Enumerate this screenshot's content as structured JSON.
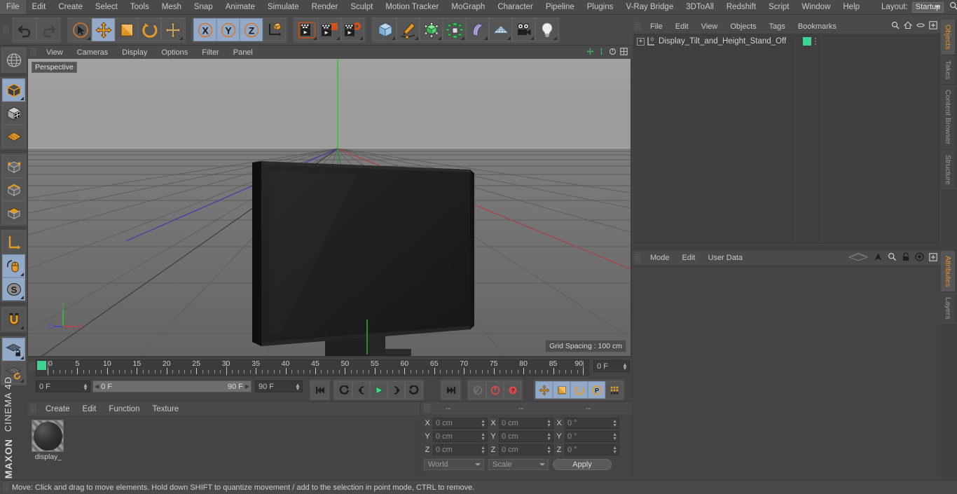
{
  "app": {
    "name": "CINEMA 4D",
    "brand_top": "MAXON",
    "brand_bottom": "CINEMA 4D"
  },
  "menubar": {
    "items": [
      "File",
      "Edit",
      "Create",
      "Select",
      "Tools",
      "Mesh",
      "Snap",
      "Animate",
      "Simulate",
      "Render",
      "Sculpt",
      "Motion Tracker",
      "MoGraph",
      "Character",
      "Pipeline",
      "Plugins",
      "V-Ray Bridge",
      "3DToAll",
      "Redshift",
      "Script",
      "Window",
      "Help"
    ],
    "layout_label": "Layout:",
    "layout_value": "Startup",
    "search_icon": "search-icon"
  },
  "main_toolbar": {
    "groups": [
      {
        "name": "undo-redo",
        "buttons": [
          {
            "icon": "undo-icon",
            "label": "Undo",
            "active": false
          },
          {
            "icon": "redo-icon",
            "label": "Redo",
            "active": false,
            "disabled": true
          }
        ]
      },
      {
        "name": "transform-tools",
        "buttons": [
          {
            "icon": "select-cursor-icon",
            "label": "Live Selection",
            "active": false
          },
          {
            "icon": "move-icon",
            "label": "Move",
            "active": true
          },
          {
            "icon": "scale-icon",
            "label": "Scale",
            "active": false
          },
          {
            "icon": "rotate-icon",
            "label": "Rotate",
            "active": false
          },
          {
            "icon": "move-alt-icon",
            "label": "Move Tool Variant",
            "active": false
          }
        ]
      },
      {
        "name": "axis-locks",
        "buttons": [
          {
            "icon": "x-axis-icon",
            "label": "X Axis",
            "active": true
          },
          {
            "icon": "y-axis-icon",
            "label": "Y Axis",
            "active": true
          },
          {
            "icon": "z-axis-icon",
            "label": "Z Axis",
            "active": true
          },
          {
            "icon": "world-coordinates-icon",
            "label": "World/Object Coordinates",
            "active": false
          }
        ]
      },
      {
        "name": "render-tools",
        "buttons": [
          {
            "icon": "render-view-icon",
            "label": "Render View",
            "active": false
          },
          {
            "icon": "render-region-icon",
            "label": "Render to Picture Viewer",
            "active": false
          },
          {
            "icon": "render-settings-icon",
            "label": "Edit Render Settings",
            "active": false
          }
        ]
      },
      {
        "name": "create-objects",
        "buttons": [
          {
            "icon": "cube-primitive-icon",
            "label": "Add Cube Object",
            "active": false
          },
          {
            "icon": "spline-pen-icon",
            "label": "Add Spline",
            "active": false
          },
          {
            "icon": "nurbs-icon",
            "label": "Add Generator Object",
            "active": false
          },
          {
            "icon": "array-icon",
            "label": "Add Array Object",
            "active": false
          },
          {
            "icon": "bend-deformer-icon",
            "label": "Add Bend Object",
            "active": false
          },
          {
            "icon": "floor-environment-icon",
            "label": "Add Floor/Environment",
            "active": false
          },
          {
            "icon": "camera-icon",
            "label": "Add Camera",
            "active": false
          },
          {
            "icon": "light-bulb-icon",
            "label": "Add Light",
            "active": false
          }
        ]
      }
    ]
  },
  "left_toolbar": {
    "buttons": [
      {
        "icon": "globe-deformed-icon",
        "label": "Make Editable",
        "active": false
      },
      {
        "icon": "model-mode-icon",
        "label": "Model Mode",
        "active": true
      },
      {
        "icon": "texture-mode-icon",
        "label": "Texture Mode",
        "active": false
      },
      {
        "icon": "workplane-icon",
        "label": "Workplane",
        "active": false
      },
      {
        "icon": "point-mode-icon",
        "label": "Points Mode",
        "active": false
      },
      {
        "icon": "edge-mode-icon",
        "label": "Edges Mode",
        "active": false
      },
      {
        "icon": "polygon-mode-icon",
        "label": "Polygons Mode",
        "active": false
      },
      {
        "icon": "axis-mode-icon",
        "label": "Enable Axis Modification",
        "active": false
      },
      {
        "icon": "viewport-solo-icon",
        "label": "Viewport Solo",
        "active": true
      },
      {
        "icon": "snap-enable-icon",
        "label": "Enable Snapping",
        "active": true
      },
      {
        "icon": "magnet-icon",
        "label": "Magnet Tool",
        "active": false
      },
      {
        "icon": "workplane-lock-icon",
        "label": "Lock Workplane",
        "active": true
      },
      {
        "icon": "workplane-rotate-icon",
        "label": "Planar Workplane Mode",
        "active": false
      }
    ]
  },
  "viewport": {
    "menu": [
      "View",
      "Cameras",
      "Display",
      "Options",
      "Filter",
      "Panel"
    ],
    "label": "Perspective",
    "grid_spacing": "Grid Spacing : 100 cm",
    "axis_labels": {
      "x": "X",
      "y": "Y",
      "z": "Z"
    },
    "axis_colors": {
      "x": "#d04040",
      "y": "#3ac03a",
      "z": "#4040d0"
    },
    "scene_object": "monitor display on stand"
  },
  "timeline": {
    "ruler": {
      "ticks": [
        0,
        5,
        10,
        15,
        20,
        25,
        30,
        35,
        40,
        45,
        50,
        55,
        60,
        65,
        70,
        75,
        80,
        85,
        90
      ],
      "start": 0,
      "end": 90,
      "current_frame_marker": 0
    },
    "current_frame_field": "0 F",
    "start_field": "0 F",
    "range_start": "0 F",
    "range_end": "90 F",
    "end_field": "90 F",
    "transport_buttons": [
      {
        "icon": "go-to-start-icon",
        "label": "Go to Start",
        "active": false
      },
      {
        "icon": "previous-key-icon",
        "label": "Go to Previous Key",
        "active": false
      },
      {
        "icon": "step-back-icon",
        "label": "Go to Previous Frame",
        "active": false
      },
      {
        "icon": "play-icon",
        "label": "Play Forwards",
        "active": false
      },
      {
        "icon": "step-forward-icon",
        "label": "Go to Next Frame",
        "active": false
      },
      {
        "icon": "next-key-icon",
        "label": "Go to Next Key",
        "active": false
      },
      {
        "icon": "go-to-end-icon",
        "label": "Go to End",
        "active": false
      }
    ],
    "record_buttons": [
      {
        "icon": "autokey-wrench-icon",
        "label": "Record Active Objects",
        "active": false
      },
      {
        "icon": "autokeying-icon",
        "label": "Autokeying",
        "active": false
      },
      {
        "icon": "keyframe-selection-icon",
        "label": "Keyframe Selection",
        "active": false
      }
    ],
    "key_toggles": [
      {
        "icon": "position-key-icon",
        "label": "Position",
        "active": true
      },
      {
        "icon": "scale-key-icon",
        "label": "Scale",
        "active": true
      },
      {
        "icon": "rotation-key-icon",
        "label": "Rotation",
        "active": true
      },
      {
        "icon": "param-key-icon",
        "label": "Parameter",
        "active": true
      },
      {
        "icon": "pla-key-icon",
        "label": "Point Level Animation",
        "active": false
      },
      {
        "icon": "timeline-strip-icon",
        "label": "Animation Layers",
        "active": true
      }
    ]
  },
  "material_manager": {
    "menu": [
      "Create",
      "Edit",
      "Function",
      "Texture"
    ],
    "materials": [
      {
        "name": "display_",
        "icon": "material-sphere-icon",
        "selected": false
      }
    ]
  },
  "coordinates": {
    "headers": [
      "--",
      "--",
      "--"
    ],
    "rows": [
      {
        "axis": "X",
        "position": "0 cm",
        "size": "0 cm",
        "rotation": "0 °"
      },
      {
        "axis": "Y",
        "position": "0 cm",
        "size": "0 cm",
        "rotation": "0 °"
      },
      {
        "axis": "Z",
        "position": "0 cm",
        "size": "0 cm",
        "rotation": "0 °"
      }
    ],
    "system_dropdown": "World",
    "mode_dropdown": "Scale",
    "apply_button": "Apply"
  },
  "object_manager": {
    "menu": [
      "File",
      "Edit",
      "View",
      "Objects",
      "Tags",
      "Bookmarks"
    ],
    "icons": [
      "search-icon",
      "home-icon",
      "ellipse-icon",
      "expand-icon"
    ],
    "items": [
      {
        "name": "Display_Tilt_and_Height_Stand_Off",
        "level_badge": "0",
        "expandable": true,
        "chip_color": "#3dd490"
      }
    ]
  },
  "attribute_manager": {
    "menu": [
      "Mode",
      "Edit",
      "User Data"
    ],
    "icons": [
      "layers-icon",
      "arrow-up-icon",
      "search-icon",
      "lock-icon",
      "target-icon",
      "expand-icon"
    ],
    "content": ""
  },
  "right_tabs": {
    "upper": [
      {
        "label": "Objects",
        "active": true
      },
      {
        "label": "Takes",
        "active": false
      },
      {
        "label": "Content Browser",
        "active": false
      },
      {
        "label": "Structure",
        "active": false
      }
    ],
    "lower": [
      {
        "label": "Attributes",
        "active": true
      },
      {
        "label": "Layers",
        "active": false
      }
    ]
  },
  "statusbar": {
    "text": "Move: Click and drag to move elements. Hold down SHIFT to quantize movement / add to the selection in point mode, CTRL to remove."
  },
  "colors": {
    "window_bg": "#414141",
    "panel_bg": "#444444",
    "toolbar_bg": "#4a4a4a",
    "active_blue": "#93a9c8",
    "accent_orange": "#e0962e",
    "green_chip": "#3dd490",
    "text": "#c8c8c8"
  }
}
